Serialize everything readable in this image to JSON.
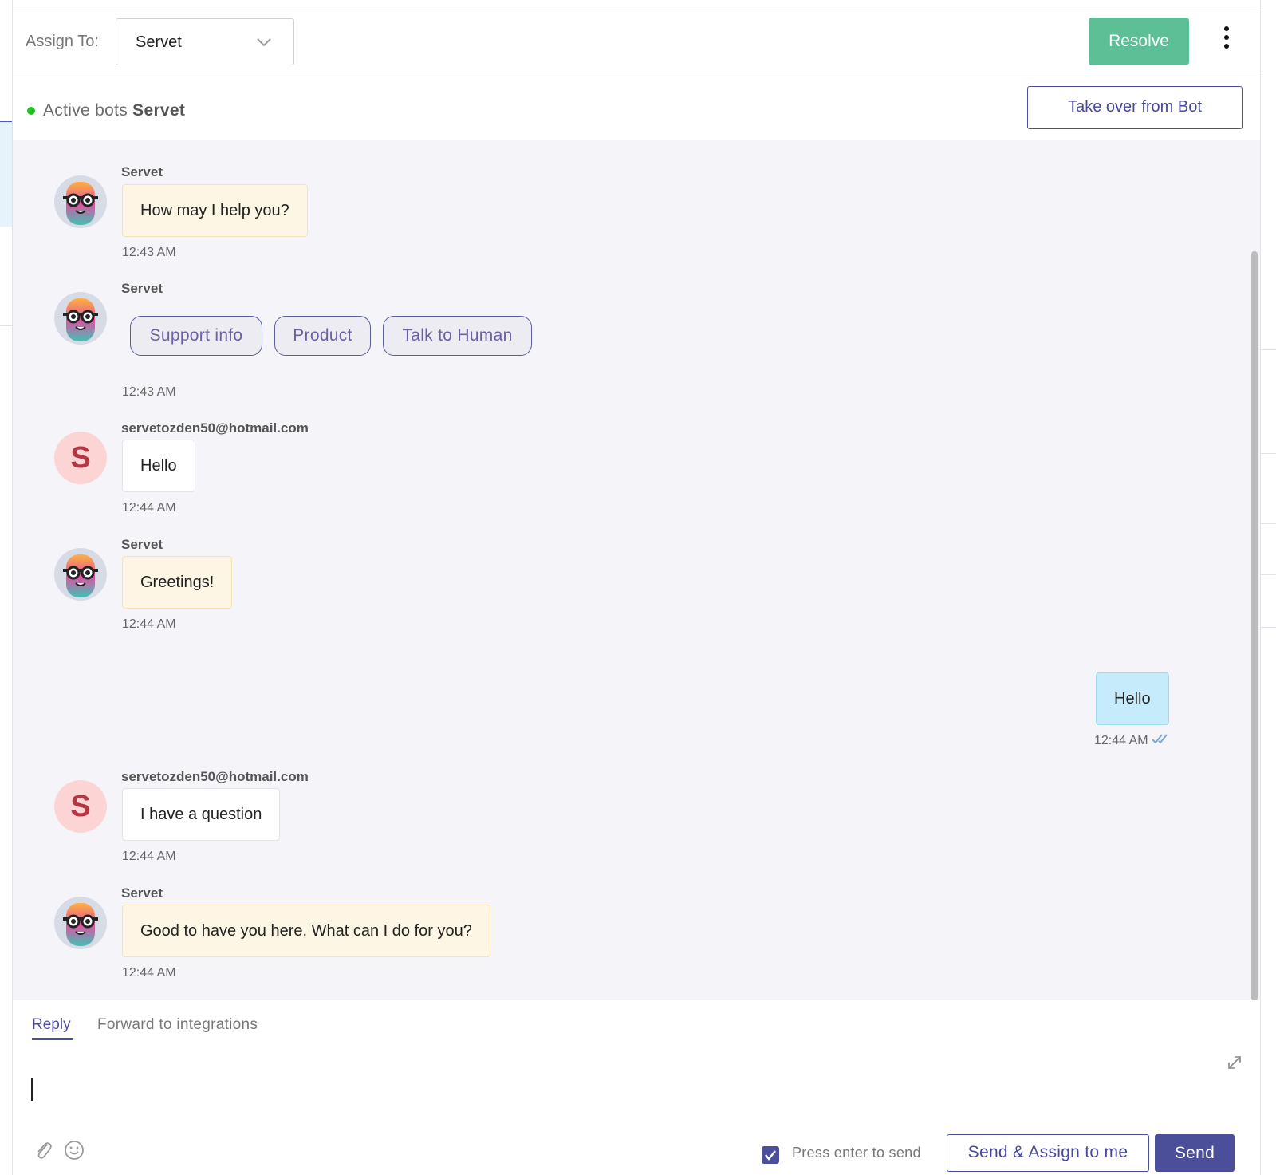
{
  "header": {
    "assign_label": "Assign To:",
    "assign_value": "Servet",
    "resolve_label": "Resolve"
  },
  "bots": {
    "active_label": "Active bots",
    "bot_name": "Servet",
    "takeover_label": "Take over from Bot",
    "status_color": "#1ec420"
  },
  "messages": [
    {
      "sender": "Servet",
      "text": "How may I help you?",
      "time": "12:43 AM"
    },
    {
      "sender": "Servet",
      "chips": [
        "Support info",
        "Product",
        "Talk to Human"
      ],
      "time": "12:43 AM"
    },
    {
      "sender": "servetozden50@hotmail.com",
      "avatar_letter": "S",
      "text": "Hello",
      "time": "12:44 AM"
    },
    {
      "sender": "Servet",
      "text": "Greetings!",
      "time": "12:44 AM"
    },
    {
      "text": "Hello",
      "time": "12:44 AM"
    },
    {
      "sender": "servetozden50@hotmail.com",
      "avatar_letter": "S",
      "text": "I have a question",
      "time": "12:44 AM"
    },
    {
      "sender": "Servet",
      "text": "Good to have you here. What can I do for you?",
      "time": "12:44 AM"
    }
  ],
  "composer": {
    "tab_reply": "Reply",
    "tab_forward": "Forward to integrations",
    "press_enter_label": "Press enter to send",
    "press_enter_checked": true,
    "send_assign_label": "Send & Assign to me",
    "send_label": "Send"
  },
  "colors": {
    "primary": "#4b4f9a",
    "resolve_green": "#5cbf95",
    "bot_bubble": "#fdf6e4",
    "agent_bubble": "#c6ebfa"
  }
}
